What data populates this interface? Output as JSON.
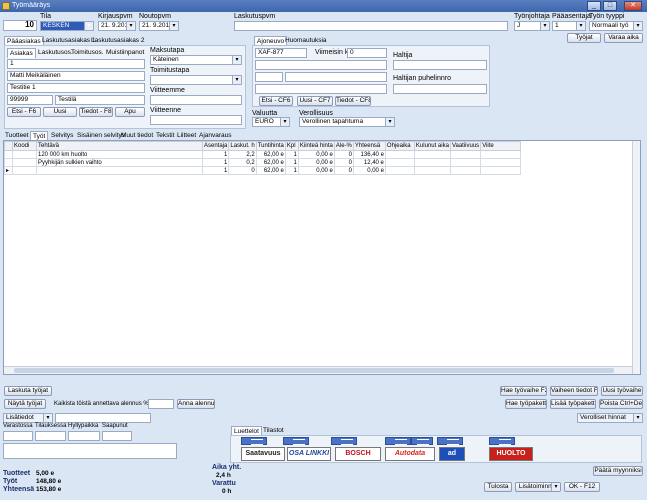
{
  "window": {
    "title": "Työmääräys"
  },
  "header": {
    "number": "10",
    "tila_label": "Tila",
    "tila_value": "KESKEN",
    "kirjauspvm_label": "Kirjauspvm",
    "kirjauspvm_value": "21. 9.2012",
    "noutopvm_label": "Noutopvm",
    "noutopvm_value": "21. 9.2012",
    "laskutuspvm_label": "Laskutuspvm",
    "tyojohtaja_label": "Työnjohtaja",
    "tyojohtaja_value": "J",
    "paaasentaja_label": "Pääasentaja",
    "paaasentaja_value": "1",
    "tyon_tyyppi_label": "Työn tyyppi",
    "tyon_tyyppi_value": "Normaali työ",
    "tyojat_button": "Työjat",
    "varaa_aika_button": "Varaa aika"
  },
  "customer": {
    "tabs": [
      "Pääasiakas",
      "Laskutusasiakas 1",
      "Laskutusasiakas 2"
    ],
    "subtabs": [
      "Asiakas",
      "Laskutusos.",
      "Toimitusos.",
      "Muistiinpanot"
    ],
    "id": "1",
    "name": "Matti Meikäläinen",
    "address": "Testitie 1",
    "postal": "99999",
    "city": "Testilä",
    "buttons": [
      "Etsi - F6",
      "Uusi",
      "Tiedot - F8",
      "Apu"
    ]
  },
  "payment": {
    "maksutapa_label": "Maksutapa",
    "maksutapa_value": "Käteinen",
    "toimitustapa_label": "Toimitustapa",
    "viitteemme_label": "Viitteemme",
    "viitteenne_label": "Viitteenne"
  },
  "vehicle": {
    "tabs": [
      "Ajoneuvo",
      "Huomautuksia"
    ],
    "plate": "XAF-877",
    "viimeisin_km_label": "Viimeisin km",
    "viimeisin_km_value": "0",
    "haltija_label": "Haltija",
    "haltijan_puhelin_label": "Haltijan puhelinnro",
    "buttons": [
      "Etsi - CF6",
      "Uusi - CF7",
      "Tiedot - CF8"
    ],
    "valuutta_label": "Valuutta",
    "valuutta_value": "EURO",
    "verollisuus_label": "Verollisuus",
    "verollisuus_value": "Verollinen tapahtuma"
  },
  "rows_tabs": [
    "Tuotteet",
    "Työt",
    "Selvitys",
    "Sisäinen selvitys",
    "Muut tiedot",
    "Tekstit",
    "Liitteet",
    "Ajanvaraus"
  ],
  "grid": {
    "columns": [
      "Koodi",
      "Tehtävä",
      "Asentaja",
      "Laskut. h",
      "Tuntihinta",
      "Kpl",
      "Kiinteä hinta",
      "Ale-%",
      "Yhteensä",
      "Ohjeaika",
      "Kulunut aika",
      "Vaatiivuus",
      "Viite"
    ],
    "rows": [
      [
        "",
        "120 000 km huolto",
        "1",
        "2,2",
        "62,00 e",
        "1",
        "0,00 e",
        "0",
        "136,40 e",
        "",
        "",
        "",
        ""
      ],
      [
        "",
        "Pyyhkijän sulkien vaihto",
        "1",
        "0,2",
        "62,00 e",
        "1",
        "0,00 e",
        "0",
        "12,40 e",
        "",
        "",
        "",
        ""
      ],
      [
        "",
        "",
        "1",
        "0",
        "62,00 e",
        "1",
        "0,00 e",
        "0",
        "0,00 e",
        "",
        "",
        "",
        ""
      ]
    ]
  },
  "actions": {
    "laskuta_tyojat": "Laskuta työjat",
    "nayta_tyojat": "Näytä työjat",
    "discount_label": "Kaikista töistä annettava alennus %",
    "anna_alennus": "Anna alennus",
    "hae_tyovaihe": "Hae työvaihe F2",
    "vaiheen_tiedot": "Vaiheen tiedot F4",
    "uusi_tyovaihe": "Uusi työvaihe",
    "hae_tyopaketti": "Hae työpaketti",
    "lisaa_tyopaketti": "Lisää työpaketti",
    "poista": "Poista Ctrl+Del",
    "lisatiedot": "Lisätiedot",
    "verolliset_hinnat": "Verolliset hinnat"
  },
  "stock": {
    "labels": [
      "Varastossa",
      "Tilauksessa",
      "Hyllypaikka",
      "Saapunut"
    ]
  },
  "catalog": {
    "tabs": [
      "Luettelot",
      "Tilastot"
    ],
    "logos": [
      "Saatavuus",
      "OSA LINKKI",
      "BOSCH",
      "Autodata",
      "ad",
      "HUOLTO"
    ]
  },
  "totals": {
    "tuotteet_label": "Tuotteet",
    "tuotteet_value": "5,00 e",
    "tyot_label": "Työt",
    "tyot_value": "148,80 e",
    "yhteensa_label": "Yhteensä",
    "yhteensa_value": "153,80 e",
    "aika_label": "Aika yht.",
    "aika_value": "2,4 h",
    "varattu_label": "Varattu",
    "varattu_value": "0 h"
  },
  "footer": {
    "paata_myynniksi": "Päätä myynniksi",
    "tulosta": "Tulosta",
    "lisatoiminnot": "Lisätoiminnot",
    "ok": "OK - F12"
  },
  "colors": {
    "window_bg": "#dbe6f4",
    "titlebar": "#3e66ad",
    "accent": "#4a73c8"
  }
}
